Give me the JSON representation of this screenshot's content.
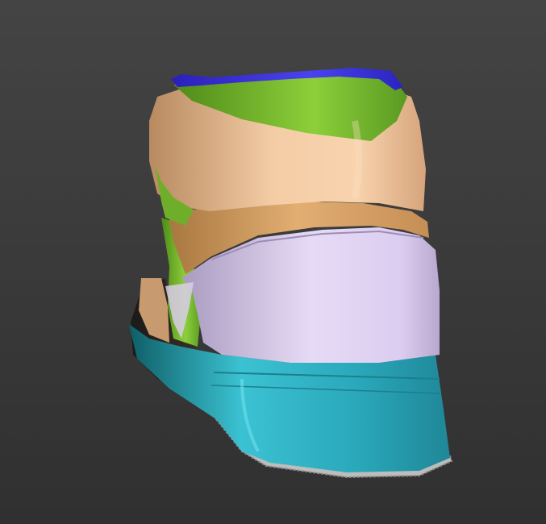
{
  "viewport": {
    "background": {
      "top": "#444444",
      "bottom": "#303030"
    }
  },
  "model": {
    "parts": [
      {
        "name": "collar-trim",
        "color": "#3a2fd6"
      },
      {
        "name": "collar-lining",
        "color": "#7fc02c"
      },
      {
        "name": "upper-heel",
        "color": "#f0c39a"
      },
      {
        "name": "strap",
        "color": "#d9a468"
      },
      {
        "name": "heel-counter",
        "color": "#d8c8ec"
      },
      {
        "name": "midsole",
        "color": "#2ab3c4"
      },
      {
        "name": "outsole",
        "color": "#bdbdbd"
      }
    ]
  }
}
